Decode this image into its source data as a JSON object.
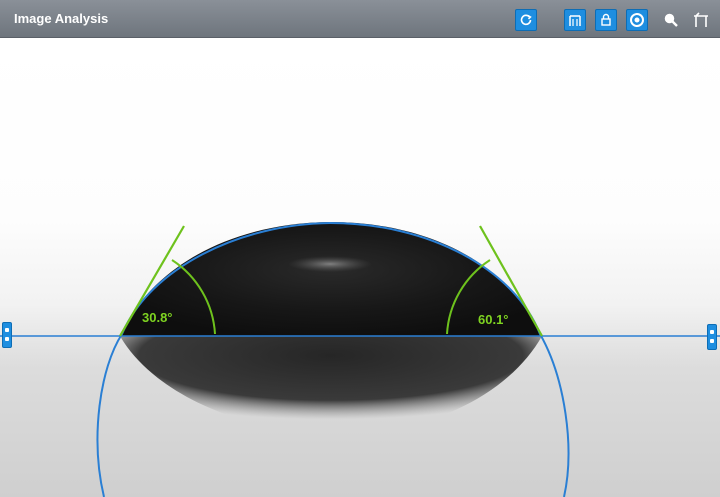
{
  "window": {
    "title": "Image Analysis"
  },
  "toolbar": {
    "buttons": [
      {
        "name": "refresh",
        "icon": "refresh-icon"
      },
      {
        "name": "baseline-tool",
        "icon": "baseline-tool-icon"
      },
      {
        "name": "lock",
        "icon": "lock-icon"
      },
      {
        "name": "record",
        "icon": "record-icon"
      },
      {
        "name": "zoom",
        "icon": "zoom-icon"
      },
      {
        "name": "table",
        "icon": "table-icon"
      }
    ]
  },
  "measurement": {
    "left_angle": "30.8°",
    "right_angle": "60.1°"
  },
  "colors": {
    "fit_line": "#2a7fd4",
    "tangent": "#6ec21d",
    "accent": "#1e8ee0",
    "droplet": "#141414"
  }
}
